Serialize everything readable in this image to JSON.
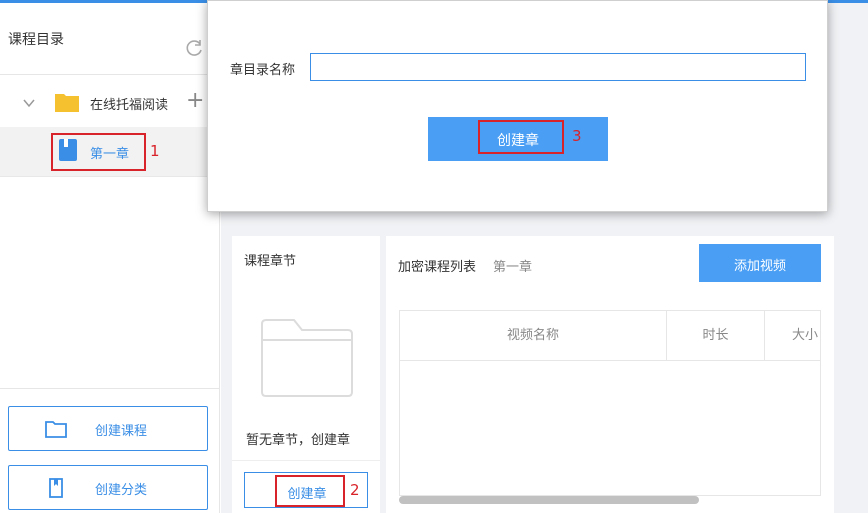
{
  "sidebar": {
    "title": "课程目录",
    "folder_label": "在线托福阅读",
    "chapter_label": "第一章",
    "annotation_1": "1",
    "create_course_label": "创建课程",
    "create_category_label": "创建分类"
  },
  "modal": {
    "field_label": "章目录名称",
    "field_value": "",
    "create_button_label": "创建章",
    "annotation_3": "3"
  },
  "chapters": {
    "title": "课程章节",
    "empty_text": "暂无章节，创建章",
    "create_button_label": "创建章",
    "annotation_2": "2"
  },
  "course_list": {
    "title": "加密课程列表",
    "current_chapter": "第一章",
    "add_video_label": "添加视频",
    "columns": [
      "视频名称",
      "时长",
      "大小"
    ]
  },
  "colors": {
    "accent": "#3a8ee6",
    "button": "#4a9ff5",
    "annotation_red": "#d9232a",
    "folder_yellow": "#f5c12e"
  },
  "icons": {
    "refresh": "refresh-icon",
    "chevron": "chevron-down-icon",
    "folder": "folder-icon",
    "add": "plus-icon",
    "book": "book-icon"
  }
}
